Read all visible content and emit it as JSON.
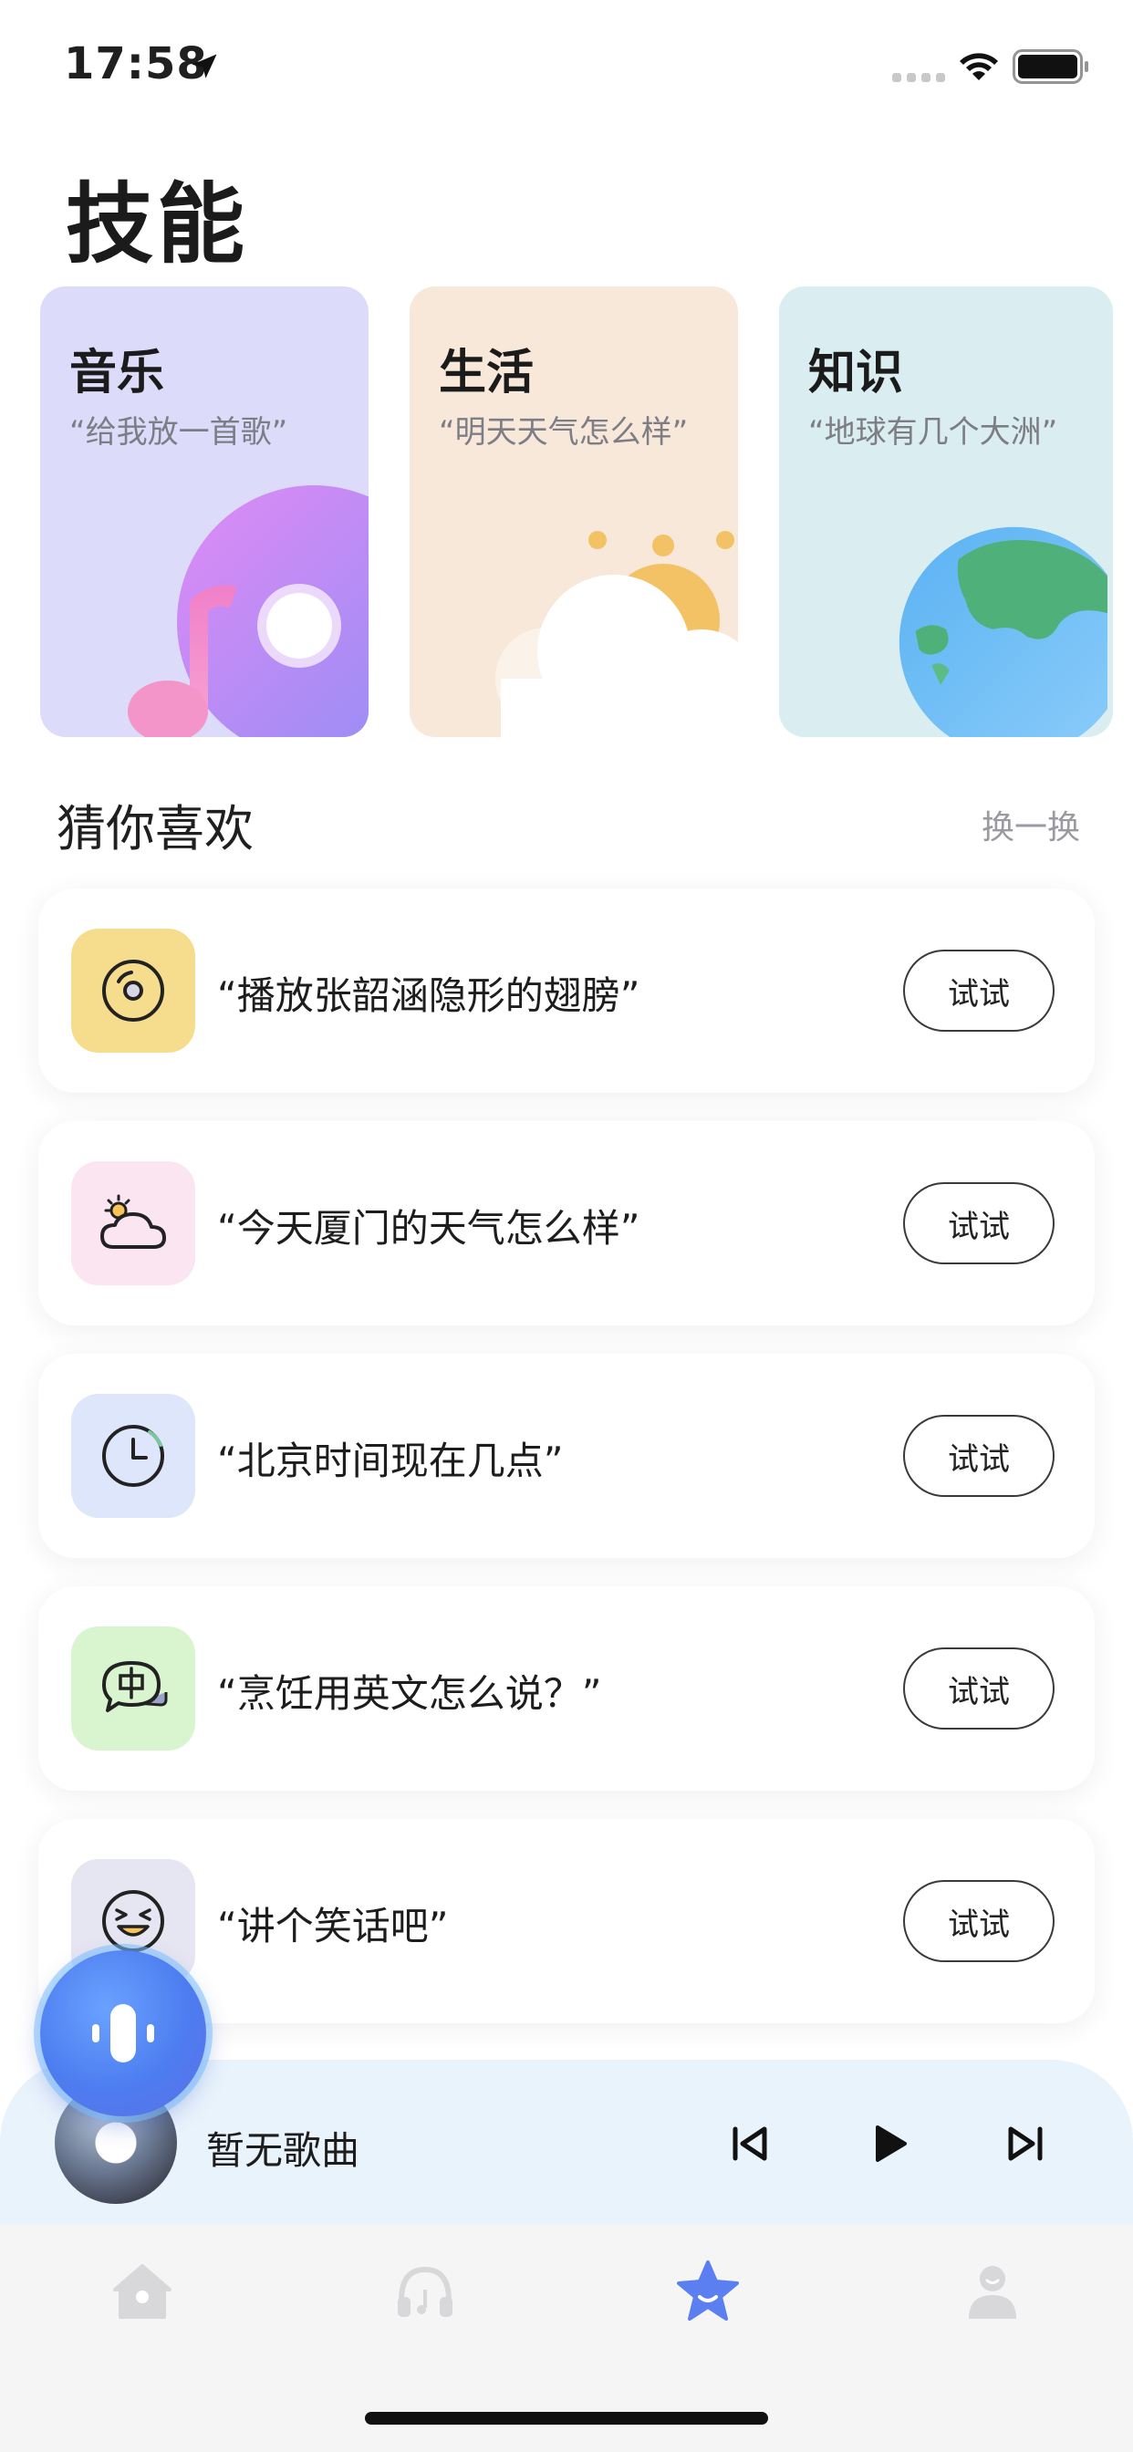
{
  "status_bar": {
    "time": "17:58"
  },
  "header": {
    "title": "技能"
  },
  "skill_cards": [
    {
      "title": "音乐",
      "example": "“给我放一首歌”",
      "color": "#dcdcfa"
    },
    {
      "title": "生活",
      "example": "“明天天气怎么样”",
      "color": "#f8e8da"
    },
    {
      "title": "知识",
      "example": "“地球有几个大洲”",
      "color": "#daedf0"
    }
  ],
  "guess": {
    "title": "猜你喜欢",
    "refresh_label": "换一换",
    "items": [
      {
        "text": "“播放张韶涵隐形的翅膀”",
        "icon": "music-disc-icon",
        "icon_bg": "#f6dd8e",
        "button": "试试"
      },
      {
        "text": "“今天厦门的天气怎么样”",
        "icon": "weather-cloud-icon",
        "icon_bg": "#fbe5f0",
        "button": "试试"
      },
      {
        "text": "“北京时间现在几点”",
        "icon": "clock-icon",
        "icon_bg": "#dde6fb",
        "button": "试试"
      },
      {
        "text": "“烹饪用英文怎么说？”",
        "icon": "translate-bubble-icon",
        "icon_bg": "#d9f5cf",
        "button": "试试"
      },
      {
        "text": "“讲个笑话吧”",
        "icon": "laughing-face-icon",
        "icon_bg": "#e6e5f2",
        "button": "试试"
      }
    ]
  },
  "player": {
    "song_title": "暂无歌曲"
  },
  "tabs": [
    {
      "name": "home",
      "icon": "home-icon",
      "active": false
    },
    {
      "name": "music",
      "icon": "headphones-icon",
      "active": false
    },
    {
      "name": "skills",
      "icon": "star-icon",
      "active": true
    },
    {
      "name": "profile",
      "icon": "person-icon",
      "active": false
    }
  ],
  "colors": {
    "accent": "#5b7ff0",
    "tab_inactive": "#d8d8da"
  }
}
